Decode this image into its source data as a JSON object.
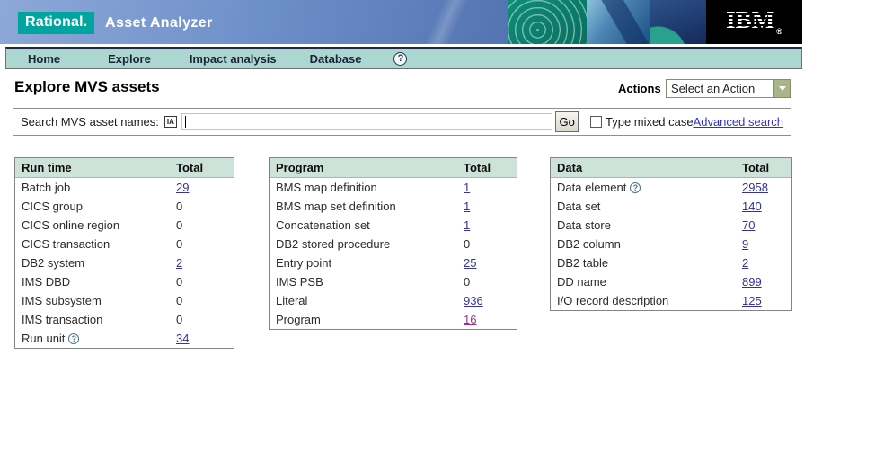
{
  "header": {
    "brand": "Rational.",
    "product": "Asset Analyzer",
    "ibm_logo": "IBM",
    "registered_mark": "®"
  },
  "nav": {
    "items": [
      "Home",
      "Explore",
      "Impact analysis",
      "Database"
    ],
    "help_glyph": "?"
  },
  "page": {
    "title": "Explore MVS assets",
    "actions_label": "Actions",
    "actions_selected": "Select an Action"
  },
  "search": {
    "label": "Search MVS asset names:",
    "case_icon": "IA",
    "input_value": "",
    "go_label": "Go",
    "checkbox_checked": false,
    "checkbox_label": "Type mixed case",
    "advanced_link": "Advanced search"
  },
  "icons": {
    "help": "?"
  },
  "colors": {
    "brand_teal": "#00a5a0",
    "banner_blue": "#5d7fbe",
    "nav_background": "#abd7d0",
    "table_header_background": "#cde2d9",
    "link_blue": "#333399",
    "link_visited": "#993399",
    "select_button_sage": "#a9b489"
  },
  "tables": [
    {
      "title": "Run time",
      "total_label": "Total",
      "rows": [
        {
          "label": "Batch job",
          "value": "29",
          "link": true
        },
        {
          "label": "CICS group",
          "value": "0",
          "link": false
        },
        {
          "label": "CICS online region",
          "value": "0",
          "link": false
        },
        {
          "label": "CICS transaction",
          "value": "0",
          "link": false
        },
        {
          "label": "DB2 system",
          "value": "2",
          "link": true
        },
        {
          "label": "IMS DBD",
          "value": "0",
          "link": false
        },
        {
          "label": "IMS subsystem",
          "value": "0",
          "link": false
        },
        {
          "label": "IMS transaction",
          "value": "0",
          "link": false
        },
        {
          "label": "Run unit",
          "value": "34",
          "link": true,
          "help": true
        }
      ]
    },
    {
      "title": "Program",
      "total_label": "Total",
      "rows": [
        {
          "label": "BMS map definition",
          "value": "1",
          "link": true
        },
        {
          "label": "BMS map set definition",
          "value": "1",
          "link": true
        },
        {
          "label": "Concatenation set",
          "value": "1",
          "link": true
        },
        {
          "label": "DB2 stored procedure",
          "value": "0",
          "link": false
        },
        {
          "label": "Entry point",
          "value": "25",
          "link": true
        },
        {
          "label": "IMS PSB",
          "value": "0",
          "link": false
        },
        {
          "label": "Literal",
          "value": "936",
          "link": true
        },
        {
          "label": "Program",
          "value": "16",
          "link": true,
          "visited": true
        }
      ]
    },
    {
      "title": "Data",
      "total_label": "Total",
      "rows": [
        {
          "label": "Data element",
          "value": "2958",
          "link": true,
          "help": true
        },
        {
          "label": "Data set",
          "value": "140",
          "link": true
        },
        {
          "label": "Data store",
          "value": "70",
          "link": true
        },
        {
          "label": "DB2 column",
          "value": "9",
          "link": true
        },
        {
          "label": "DB2 table",
          "value": "2",
          "link": true
        },
        {
          "label": "DD name",
          "value": "899",
          "link": true
        },
        {
          "label": "I/O record description",
          "value": "125",
          "link": true
        }
      ]
    }
  ]
}
